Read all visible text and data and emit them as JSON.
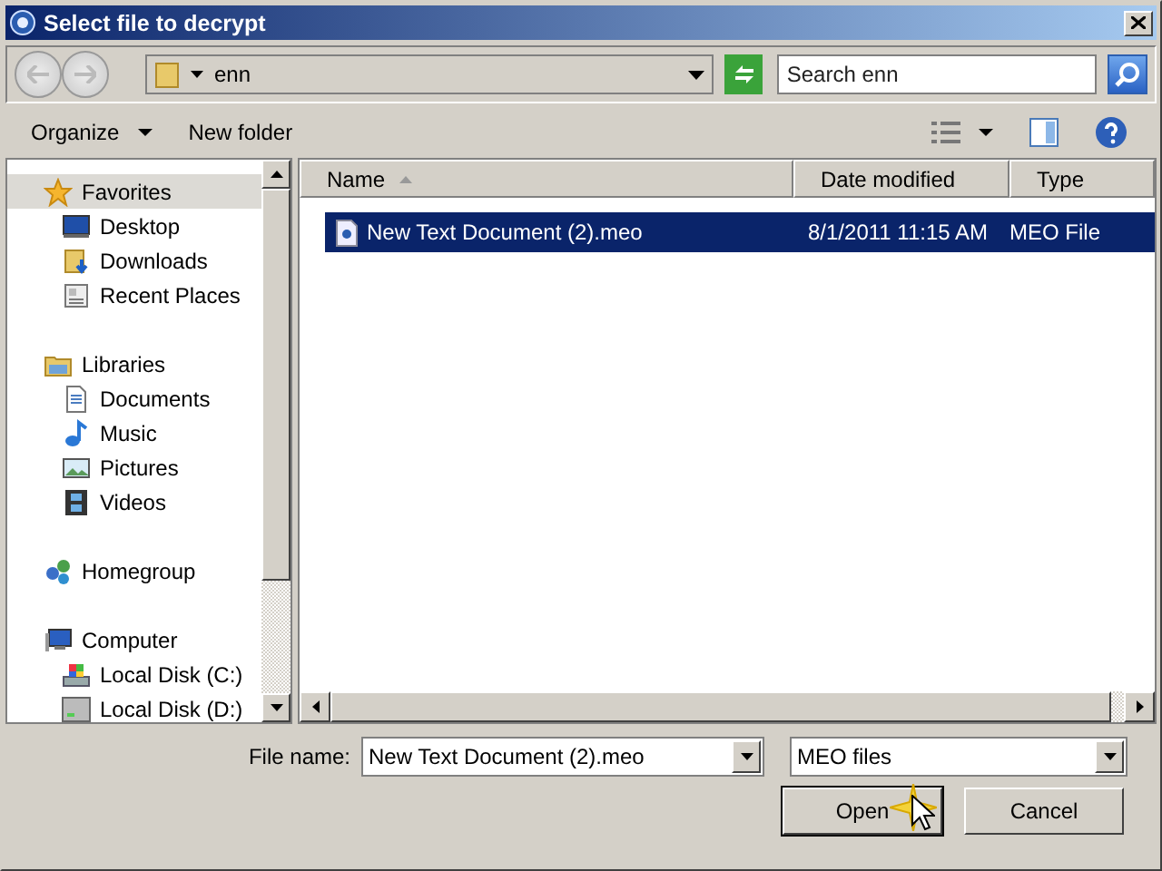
{
  "window": {
    "title": "Select file to decrypt"
  },
  "address_bar": {
    "path": "enn",
    "search": {
      "placeholder": "Search enn"
    }
  },
  "toolbar": {
    "buttons": [
      {
        "label": "Organize",
        "dropdown": true
      },
      {
        "label": "New folder",
        "dropdown": false
      }
    ]
  },
  "navigation": [
    {
      "label": "Favorites",
      "kind": "favorites",
      "selected": true,
      "children": [
        {
          "label": "Desktop",
          "kind": "desktop",
          "selected": false
        },
        {
          "label": "Downloads",
          "kind": "downloads",
          "selected": false
        },
        {
          "label": "Recent Places",
          "kind": "places",
          "selected": false
        }
      ]
    },
    {
      "label": "Libraries",
      "kind": "libraries",
      "selected": false,
      "children": [
        {
          "label": "Documents",
          "kind": "documents",
          "selected": false
        },
        {
          "label": "Music",
          "kind": "music",
          "selected": false
        },
        {
          "label": "Pictures",
          "kind": "pictures",
          "selected": false
        },
        {
          "label": "Videos",
          "kind": "videos",
          "selected": false
        }
      ]
    },
    {
      "label": "Homegroup",
      "kind": "homegroup",
      "selected": false
    },
    {
      "label": "Computer",
      "kind": "computer",
      "selected": false,
      "children": [
        {
          "label": "Local Disk (C:)",
          "kind": "system",
          "selected": false
        },
        {
          "label": "Local Disk (D:)",
          "kind": "disk",
          "selected": false
        }
      ]
    }
  ],
  "file_list": {
    "columns": [
      {
        "label": "Name",
        "sorted": true
      },
      {
        "label": "Date modified",
        "sorted": false
      },
      {
        "label": "Type",
        "sorted": false
      }
    ],
    "rows": [
      {
        "cells": [
          "New Text Document (2).meo",
          "8/1/2011 11:15 AM",
          "MEO File"
        ],
        "selected": true
      }
    ]
  },
  "footer": {
    "file_name": {
      "label": "File name:",
      "value": "New Text Document (2).meo"
    },
    "file_type": {
      "value": "MEO files"
    },
    "buttons": [
      {
        "label": "Open",
        "default": true
      },
      {
        "label": "Cancel",
        "default": false
      }
    ]
  }
}
